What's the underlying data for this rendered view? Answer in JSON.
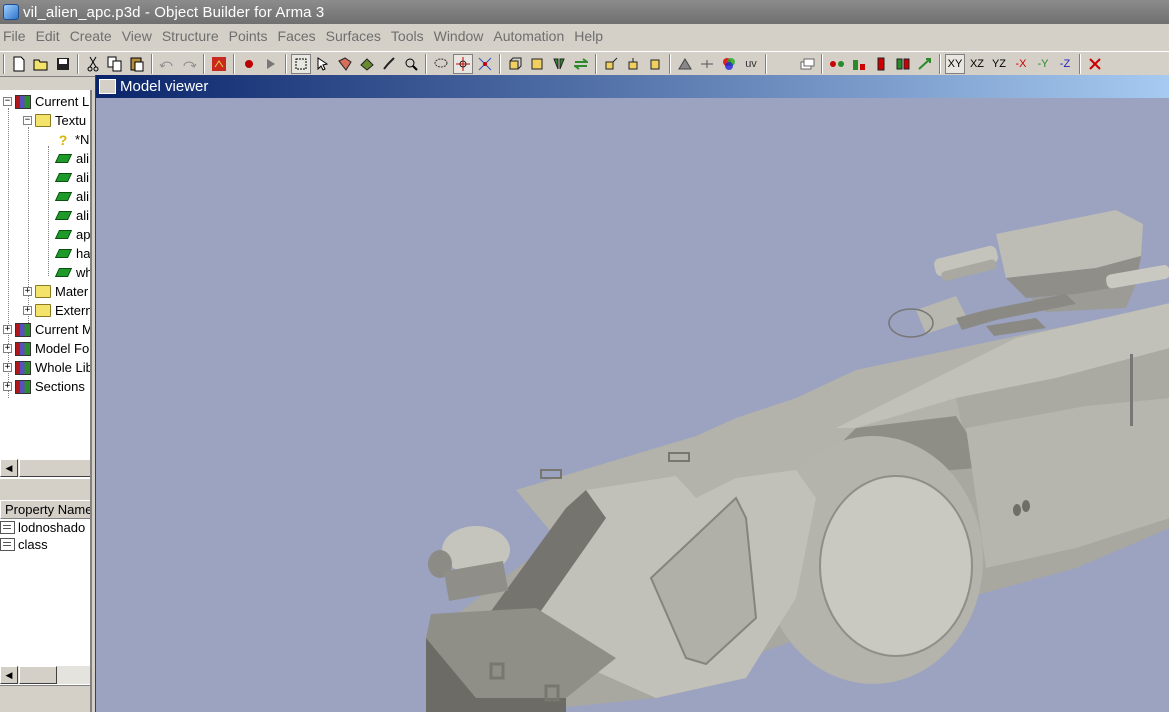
{
  "window": {
    "title": "vil_alien_apc.p3d - Object Builder for Arma 3"
  },
  "menu": [
    "File",
    "Edit",
    "Create",
    "View",
    "Structure",
    "Points",
    "Faces",
    "Surfaces",
    "Tools",
    "Window",
    "Automation",
    "Help"
  ],
  "toolbar": {
    "uv_label": "uv",
    "axes": [
      "XY",
      "XZ",
      "YZ",
      "-X",
      "-Y",
      "-Z"
    ]
  },
  "tree": {
    "items": [
      {
        "label": "Current L",
        "icon": "library-icon"
      },
      {
        "label": "Textu",
        "icon": "folder-icon"
      },
      {
        "label": "*N",
        "icon": "question-icon"
      },
      {
        "label": "ali",
        "icon": "texture-icon"
      },
      {
        "label": "ali",
        "icon": "texture-icon"
      },
      {
        "label": "ali",
        "icon": "texture-icon"
      },
      {
        "label": "ali",
        "icon": "texture-icon"
      },
      {
        "label": "ap",
        "icon": "texture-icon"
      },
      {
        "label": "ha",
        "icon": "texture-icon"
      },
      {
        "label": "wh",
        "icon": "texture-icon"
      },
      {
        "label": "Mater",
        "icon": "folder-icon"
      },
      {
        "label": "Extern",
        "icon": "folder-icon"
      },
      {
        "label": "Current M",
        "icon": "library-icon"
      },
      {
        "label": "Model Fo",
        "icon": "library-icon"
      },
      {
        "label": "Whole Lib",
        "icon": "library-icon"
      },
      {
        "label": "Sections",
        "icon": "library-icon"
      }
    ]
  },
  "properties": {
    "header": "Property Name",
    "rows": [
      "lodnoshado",
      "class"
    ]
  },
  "viewer": {
    "title": "Model viewer",
    "background": "#9ba3c1"
  }
}
